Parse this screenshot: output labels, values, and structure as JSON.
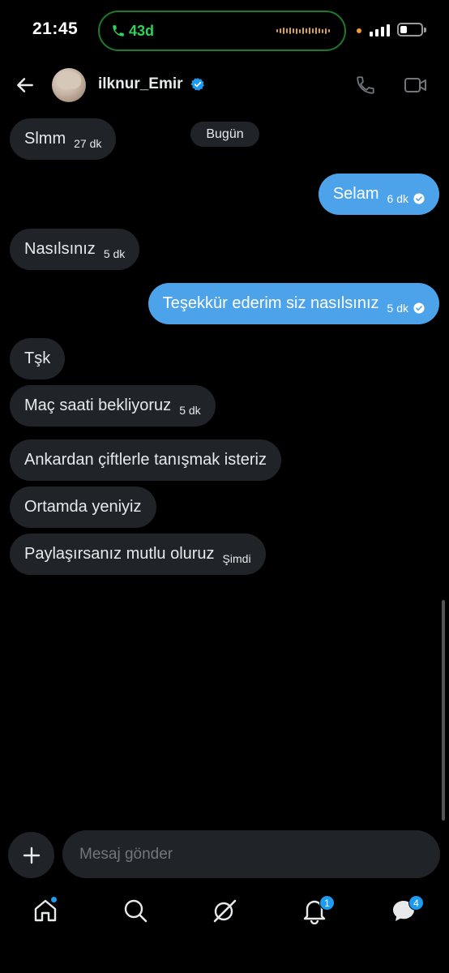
{
  "status_bar": {
    "time": "21:45",
    "call_duration": "43d",
    "colors": {
      "call": "#31d158",
      "recording_dot": "#f29a3b"
    }
  },
  "header": {
    "username": "ilknur_Emir",
    "verified": true,
    "icons": [
      "back-arrow-icon",
      "phone-icon",
      "video-call-icon"
    ]
  },
  "conversation": {
    "date_label": "Bugün",
    "messages": [
      {
        "dir": "in",
        "text": "Slmm",
        "time": "27 dk"
      },
      {
        "dir": "out",
        "text": "Selam",
        "time": "6 dk",
        "seen": true
      },
      {
        "dir": "in",
        "text": "Nasılsınız",
        "time": "5 dk"
      },
      {
        "dir": "out",
        "text": "Teşekkür ederim siz nasılsınız",
        "time": "5 dk",
        "seen": true
      },
      {
        "dir": "in",
        "text": "Tşk",
        "time": ""
      },
      {
        "dir": "in",
        "text": "Maç saati bekliyoruz",
        "time": "5 dk"
      },
      {
        "dir": "in",
        "text": "Ankardan çiftlerle tanışmak isteriz",
        "time": ""
      },
      {
        "dir": "in",
        "text": "Ortamda yeniyiz",
        "time": ""
      },
      {
        "dir": "in",
        "text": "Paylaşırsanız mutlu oluruz",
        "time": "Şimdi"
      }
    ],
    "colors": {
      "incoming": "#202327",
      "outgoing": "#4da3ea"
    }
  },
  "composer": {
    "placeholder": "Mesaj gönder",
    "value": ""
  },
  "bottom_nav": {
    "items": [
      "home-icon",
      "search-icon",
      "grok-icon",
      "notifications-icon",
      "messages-icon"
    ],
    "notifications_badge": "1",
    "messages_badge": "4"
  }
}
